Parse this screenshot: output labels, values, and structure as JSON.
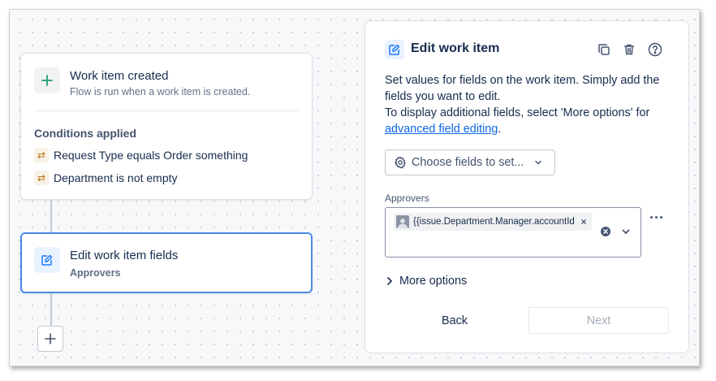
{
  "trigger": {
    "title": "Work item created",
    "subtitle": "Flow is run when a work item is created.",
    "conditions_heading": "Conditions applied",
    "conditions": [
      {
        "label": "Request Type equals Order something",
        "icon": "swap-icon"
      },
      {
        "label": "Department is not empty",
        "icon": "swap-icon"
      }
    ]
  },
  "action": {
    "title": "Edit work item fields",
    "subtitle": "Approvers"
  },
  "panel": {
    "title": "Edit work item",
    "tools": [
      "duplicate-icon",
      "trash-icon",
      "help-icon"
    ],
    "description_line1": "Set values for fields on the work item. Simply add the fields you want to edit.",
    "description_line2": "To display additional fields, select 'More options' for",
    "description_link": "advanced field editing",
    "description_end": ".",
    "choose_fields_label": "Choose fields to set...",
    "field": {
      "label": "Approvers",
      "chip_value": "{{issue.Department.Manager.accountId}}"
    },
    "more_options_label": "More options",
    "back_label": "Back",
    "next_label": "Next"
  },
  "colors": {
    "accent": "#0c66e4",
    "selected_border": "#4a8be8",
    "condition_icon": "#b5761b",
    "add_icon": "#22a06b"
  }
}
